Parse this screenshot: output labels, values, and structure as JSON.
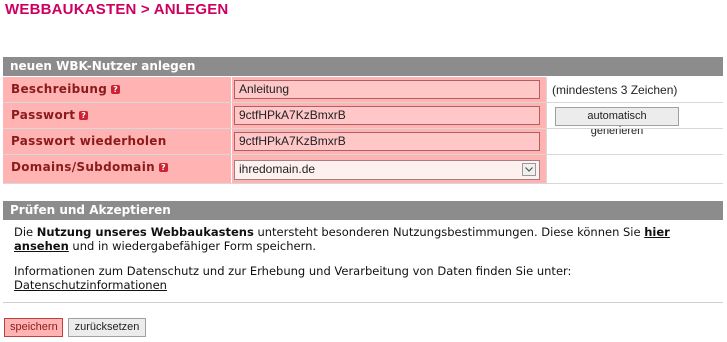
{
  "page": {
    "title": "WEBBAUKASTEN > ANLEGEN"
  },
  "form": {
    "header": "neuen WBK-Nutzer anlegen",
    "fields": {
      "beschreibung": {
        "label": "Beschreibung",
        "value": "Anleitung",
        "hint": "(mindestens 3 Zeichen)",
        "help_icon": "help-icon"
      },
      "passwort": {
        "label": "Passwort",
        "value": "9ctfHPkA7KzBmxrB",
        "button": "automatisch generieren",
        "help_icon": "help-icon"
      },
      "passwort_wiederholen": {
        "label": "Passwort wiederholen",
        "value": "9ctfHPkA7KzBmxrB"
      },
      "domains": {
        "label": "Domains/Subdomain",
        "selected": "ihredomain.de",
        "help_icon": "help-icon",
        "arrow_icon": "chevron-down-icon"
      }
    }
  },
  "review": {
    "header": "Prüfen und Akzeptieren",
    "para1": {
      "pre": "Die ",
      "bold": "Nutzung unseres Webbaukastens",
      "mid": " untersteht besonderen Nutzungsbestimmungen. Diese können Sie ",
      "link": "hier ansehen",
      "post": " und in wiedergabefähiger Form speichern."
    },
    "para2": {
      "text": "Informationen zum Datenschutz und zur Erhebung und Verarbeitung von Daten finden Sie unter:",
      "link": "Datenschutzinformationen"
    }
  },
  "actions": {
    "save": "speichern",
    "reset": "zurücksetzen"
  },
  "colors": {
    "accent": "#cc0060",
    "header_bg": "#8c8c8c",
    "row_bg": "#ffb3b3",
    "field_bg": "#ffc7c7",
    "label": "#8b1a1a"
  }
}
